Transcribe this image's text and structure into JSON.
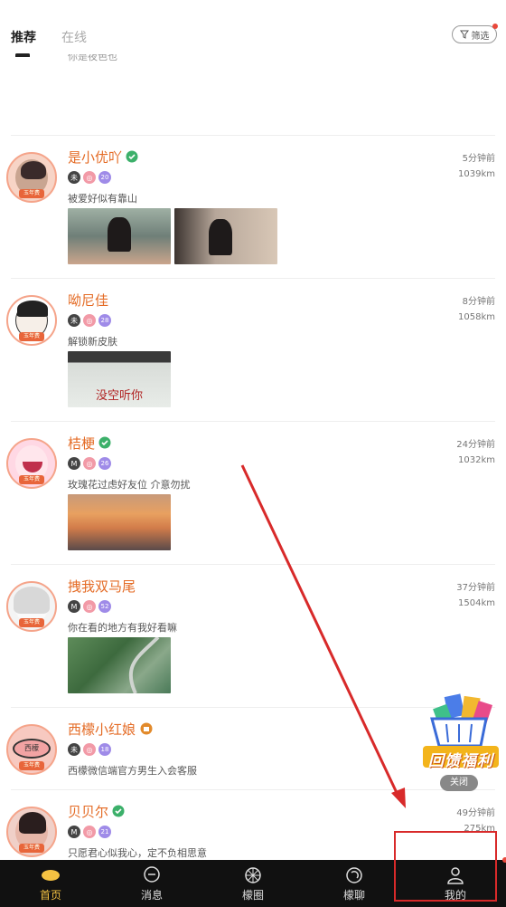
{
  "tabs": {
    "recommend": "推荐",
    "online": "在线"
  },
  "filter": {
    "label": "筛选"
  },
  "partial_bio": "你是夜色也",
  "posts": [
    {
      "name": "是小优吖",
      "verified": true,
      "level": "20",
      "bio": "被爱好似有靠山",
      "time": "5分钟前",
      "distance": "1039km"
    },
    {
      "name": "呦尼佳",
      "verified": false,
      "level": "28",
      "bio": "解锁新皮肤",
      "time": "8分钟前",
      "distance": "1058km",
      "photo_text": "没空听你"
    },
    {
      "name": "桔梗",
      "verified": true,
      "level": "26",
      "bio": "玫瑰花过虑好友位 介意勿扰",
      "time": "24分钟前",
      "distance": "1032km"
    },
    {
      "name": "拽我双马尾",
      "verified": false,
      "level": "52",
      "bio": "你在看的地方有我好看嘛",
      "time": "37分钟前",
      "distance": "1504km"
    },
    {
      "name": "西檬小红娘",
      "verified": true,
      "level": "18",
      "bio": "西檬微信端官方男生入会客服",
      "time": "",
      "distance": "",
      "avatar_text": "西檬"
    },
    {
      "name": "贝贝尔",
      "verified": true,
      "level": "21",
      "bio": "只愿君心似我心，定不负相思意",
      "time": "49分钟前",
      "distance": "275km"
    }
  ],
  "badge_labels": {
    "unknown": "未",
    "member": "M"
  },
  "avatar_tag": "玉年费",
  "promo": {
    "title": "回馈福利",
    "close": "关闭"
  },
  "nav": [
    {
      "label": "首页",
      "icon": "home-lemon-icon"
    },
    {
      "label": "消息",
      "icon": "message-icon"
    },
    {
      "label": "檬圈",
      "icon": "circle-icon"
    },
    {
      "label": "檬聊",
      "icon": "chat-icon"
    },
    {
      "label": "我的",
      "icon": "profile-icon"
    }
  ],
  "colors": {
    "name": "#e46b25",
    "active_nav": "#f5c242",
    "annotation": "#d82a2a"
  }
}
